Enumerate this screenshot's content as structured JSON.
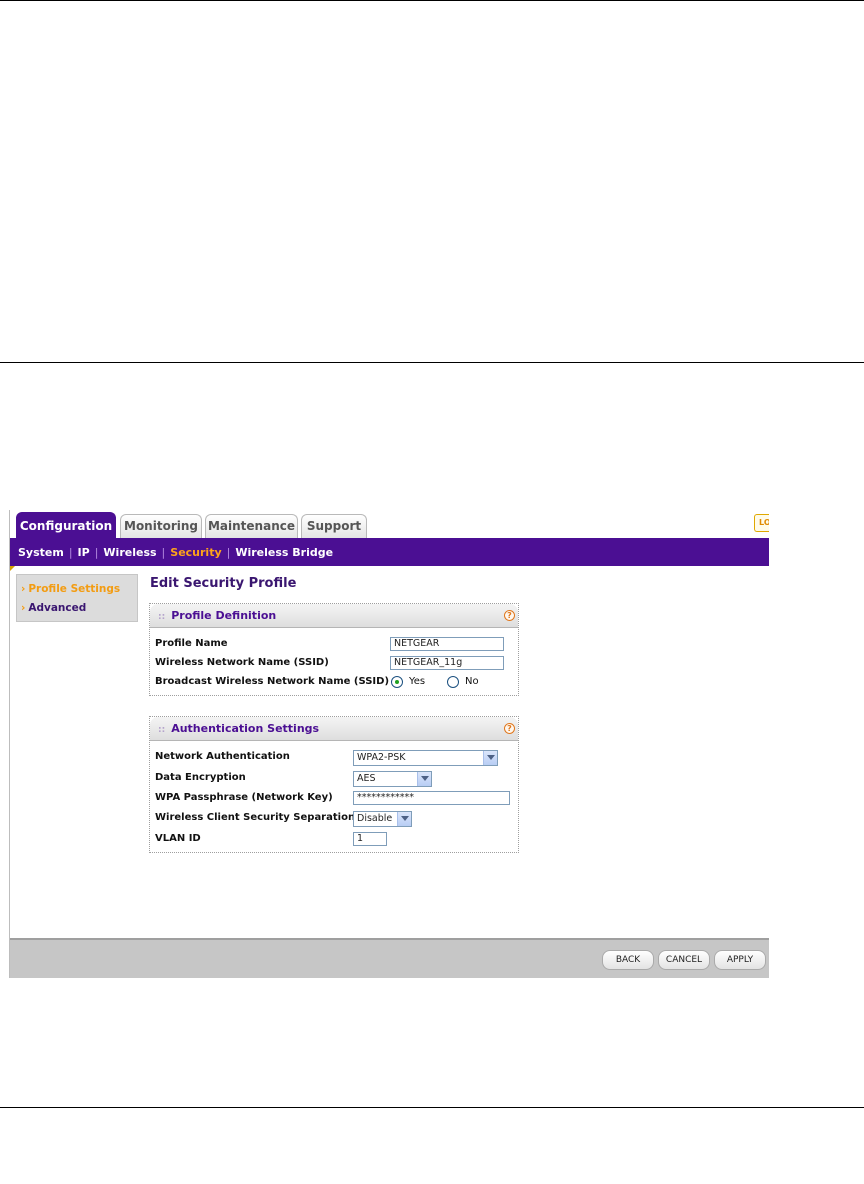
{
  "tabs": [
    {
      "label": "Configuration",
      "active": true
    },
    {
      "label": "Monitoring",
      "active": false
    },
    {
      "label": "Maintenance",
      "active": false
    },
    {
      "label": "Support",
      "active": false
    }
  ],
  "logout_stub": "LO",
  "subnav": [
    {
      "label": "System",
      "active": false
    },
    {
      "label": "IP",
      "active": false
    },
    {
      "label": "Wireless",
      "active": false
    },
    {
      "label": "Security",
      "active": true
    },
    {
      "label": "Wireless Bridge",
      "active": false
    }
  ],
  "sidebar": [
    {
      "label": "Profile Settings",
      "active": true
    },
    {
      "label": "Advanced",
      "active": false
    }
  ],
  "page_title": "Edit Security Profile",
  "profile_definition": {
    "title": "Profile Definition",
    "profile_name_label": "Profile Name",
    "profile_name_value": "NETGEAR",
    "ssid_label": "Wireless Network Name (SSID)",
    "ssid_value": "NETGEAR_11g",
    "broadcast_label": "Broadcast Wireless Network Name (SSID)",
    "broadcast_yes": "Yes",
    "broadcast_no": "No",
    "broadcast_selected": "Yes"
  },
  "authentication": {
    "title": "Authentication Settings",
    "network_auth_label": "Network Authentication",
    "network_auth_value": "WPA2-PSK",
    "data_encryption_label": "Data Encryption",
    "data_encryption_value": "AES",
    "passphrase_label": "WPA Passphrase (Network Key)",
    "passphrase_value": "************",
    "separation_label": "Wireless Client Security Separation",
    "separation_value": "Disable",
    "vlan_label": "VLAN ID",
    "vlan_value": "1"
  },
  "help_glyph": "?",
  "buttons": {
    "back": "BACK",
    "cancel": "CANCEL",
    "apply": "APPLY"
  },
  "colors": {
    "brand_purple": "#4b0f93",
    "accent_orange": "#f39c12",
    "footer_gray": "#c6c6c6"
  }
}
